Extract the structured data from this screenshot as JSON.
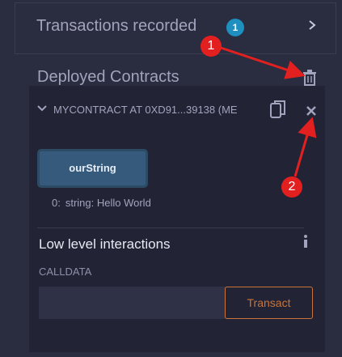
{
  "transactions": {
    "title": "Transactions recorded",
    "badge": "1"
  },
  "deployed": {
    "title": "Deployed Contracts",
    "contract_name": "MYCONTRACT AT 0XD91...39138 (ME",
    "function_button": "ourString",
    "result_index": "0:",
    "result_value": "string: Hello World",
    "low_level_title": "Low level interactions",
    "calldata_label": "CALLDATA",
    "calldata_value": "",
    "transact_label": "Transact"
  },
  "annotations": {
    "marker1": "1",
    "marker2": "2"
  },
  "colors": {
    "background": "#2a2c3f",
    "card": "#222335",
    "accent": "#c97539",
    "button": "#355a7c",
    "badge": "#1e8fbf",
    "annotation": "#e32020"
  },
  "icons": [
    "chevron-right-icon",
    "trash-icon",
    "caret-down-icon",
    "copy-icon",
    "close-icon",
    "info-icon"
  ]
}
